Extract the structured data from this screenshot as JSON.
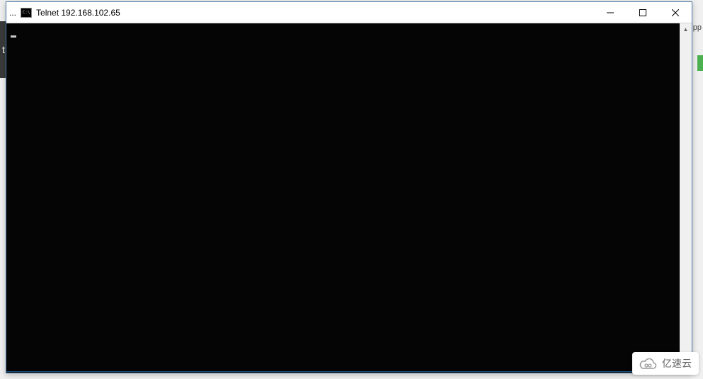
{
  "background": {
    "left_strip_char": "t",
    "side_label": "pp"
  },
  "window": {
    "title_prefix": "...",
    "app_icon_label": "C:\\",
    "title": "Telnet 192.168.102.65"
  },
  "controls": {
    "minimize": "Minimize",
    "maximize": "Maximize",
    "close": "Close"
  },
  "terminal": {
    "content": ""
  },
  "watermark": {
    "text": "亿速云"
  }
}
